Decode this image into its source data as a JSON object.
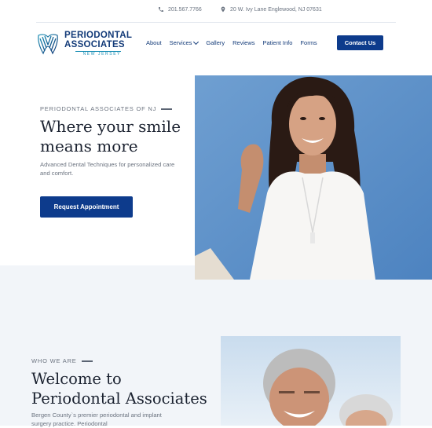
{
  "topbar": {
    "phone": "201.567.7766",
    "address": "20 W. Ivy Lane Englewood, NJ 07631"
  },
  "logo": {
    "line1": "PERIODONTAL",
    "line2": "ASSOCIATES",
    "line3": "NEW JERSEY"
  },
  "nav": {
    "items": [
      {
        "label": "About"
      },
      {
        "label": "Services"
      },
      {
        "label": "Gallery"
      },
      {
        "label": "Reviews"
      },
      {
        "label": "Patient Info"
      },
      {
        "label": "Forms"
      }
    ],
    "cta": "Contact Us"
  },
  "hero": {
    "eyebrow": "PERIODONTAL ASSOCIATES OF NJ",
    "title": "Where your smile means more",
    "subtitle": "Advanced Dental Techniques for personalized care and comfort.",
    "cta": "Request Appointment"
  },
  "welcome": {
    "eyebrow": "WHO WE ARE",
    "title": "Welcome to Periodontal Associates",
    "text": "Bergen County`s premier periodontal and implant surgery practice. Periodontal"
  },
  "colors": {
    "brand_navy": "#0d3b8c",
    "brand_teal": "#1b8fb5",
    "hero_blue": "#5b8fc6",
    "section_bg": "#f2f5f9"
  }
}
